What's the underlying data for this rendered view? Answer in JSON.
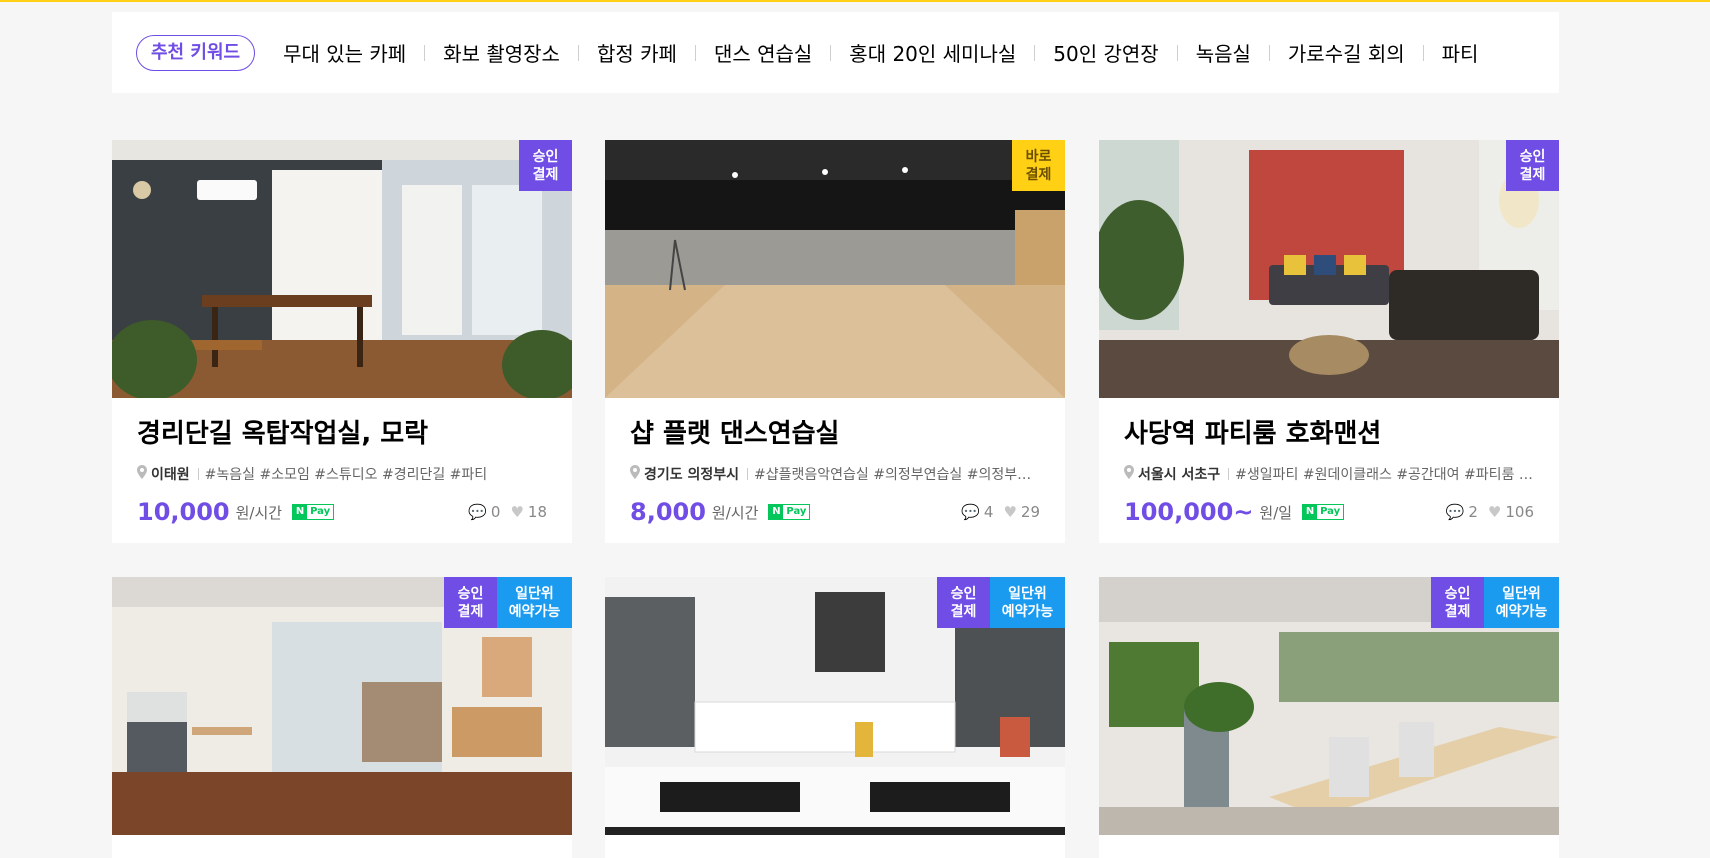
{
  "keywords": {
    "badge": "추천 키워드",
    "items": [
      "무대 있는 카페",
      "화보 촬영장소",
      "합정 카페",
      "댄스 연습실",
      "홍대 20인 세미나실",
      "50인 강연장",
      "녹음실",
      "가로수길 회의",
      "파티"
    ]
  },
  "colors": {
    "accent": "#704de4",
    "instant": "#ffd014",
    "daily": "#1a9bf0",
    "npay": "#03c75a"
  },
  "cards": [
    {
      "title": "경리단길 옥탑작업실, 모락",
      "location": "이태원",
      "tags": "#녹음실  #소모임  #스튜디오  #경리단길  #파티",
      "price": "10,000",
      "unit": "원/시간",
      "npay": "Pay",
      "comments": "0",
      "likes": "18",
      "badges": [
        {
          "type": "approve",
          "line1": "승인",
          "line2": "결제"
        }
      ]
    },
    {
      "title": "샵 플랫 댄스연습실",
      "location": "경기도 의정부시",
      "tags": "#샵플랫음악연습실  #의정부연습실  #의정부…",
      "price": "8,000",
      "unit": "원/시간",
      "npay": "Pay",
      "comments": "4",
      "likes": "29",
      "badges": [
        {
          "type": "instant",
          "line1": "바로",
          "line2": "결제"
        }
      ]
    },
    {
      "title": "사당역 파티룸 호화맨션",
      "location": "서울시 서초구",
      "tags": "#생일파티  #원데이클래스  #공간대여  #파티룸 …",
      "price": "100,000~",
      "unit": "원/일",
      "npay": "Pay",
      "comments": "2",
      "likes": "106",
      "badges": [
        {
          "type": "approve",
          "line1": "승인",
          "line2": "결제"
        }
      ]
    },
    {
      "badges": [
        {
          "type": "approve",
          "line1": "승인",
          "line2": "결제"
        },
        {
          "type": "daily",
          "line1": "일단위",
          "line2": "예약가능"
        }
      ]
    },
    {
      "badges": [
        {
          "type": "approve",
          "line1": "승인",
          "line2": "결제"
        },
        {
          "type": "daily",
          "line1": "일단위",
          "line2": "예약가능"
        }
      ]
    },
    {
      "badges": [
        {
          "type": "approve",
          "line1": "승인",
          "line2": "결제"
        },
        {
          "type": "daily",
          "line1": "일단위",
          "line2": "예약가능"
        }
      ]
    }
  ]
}
